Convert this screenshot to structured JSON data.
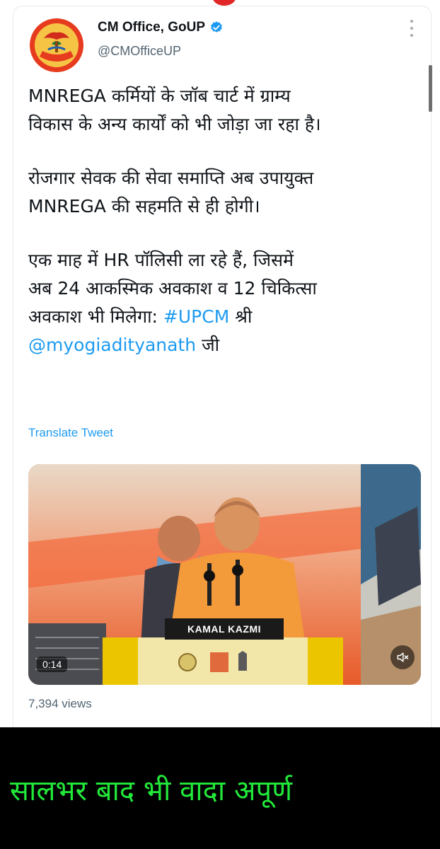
{
  "tweet": {
    "author_name": "CM Office, GoUP",
    "handle": "@CMOfficeUP",
    "verified": true,
    "paragraph1": [
      "MNREGA कर्मियों के जॉब चार्ट में ग्राम्य",
      "विकास के अन्य कार्यों को भी जोड़ा जा रहा है।"
    ],
    "paragraph2": [
      "रोजगार सेवक की सेवा समाप्ति अब उपायुक्त",
      "MNREGA की सहमति से ही होगी।"
    ],
    "paragraph3": [
      "एक माह में HR पॉलिसी ला रहे हैं, जिसमें",
      "अब 24 आकस्मिक अवकाश व 12 चिकित्सा"
    ],
    "paragraph3_line3_text": "अवकाश भी मिलेगा: ",
    "hashtag": "#UPCM",
    "after_hashtag": " श्री",
    "mention": "@myogiadityanath",
    "after_mention": " जी",
    "translate_label": "Translate Tweet",
    "video": {
      "duration": "0:14",
      "podium_sign": "KAMAL  KAZMI"
    },
    "views": "7,394 views"
  },
  "caption": "सालभर बाद भी वादा अपूर्ण",
  "colors": {
    "link": "#1d9bf0",
    "caption": "#22e83a",
    "background": "#000000"
  },
  "icons": [
    "verified-badge-icon",
    "more-options-icon",
    "mute-icon"
  ]
}
